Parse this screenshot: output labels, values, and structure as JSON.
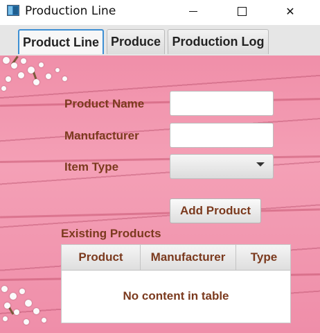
{
  "window": {
    "title": "Production Line",
    "icon": "app-icon",
    "controls": {
      "minimize": "minimize-icon",
      "maximize": "maximize-icon",
      "close": "✕"
    }
  },
  "tabs": [
    {
      "label": "Product Line",
      "selected": true
    },
    {
      "label": "Produce",
      "selected": false
    },
    {
      "label": "Production Log",
      "selected": false
    }
  ],
  "form": {
    "product_name_label": "Product Name",
    "product_name_value": "",
    "manufacturer_label": "Manufacturer",
    "manufacturer_value": "",
    "item_type_label": "Item Type",
    "item_type_value": "",
    "add_button_label": "Add Product"
  },
  "existing_products": {
    "title": "Existing Products",
    "columns": [
      "Product",
      "Manufacturer",
      "Type"
    ],
    "rows": [],
    "empty_text": "No content in table"
  },
  "colors": {
    "label_text": "#7b3a1e",
    "background": "#f29ab1",
    "tab_focus": "#3d8fd4"
  }
}
